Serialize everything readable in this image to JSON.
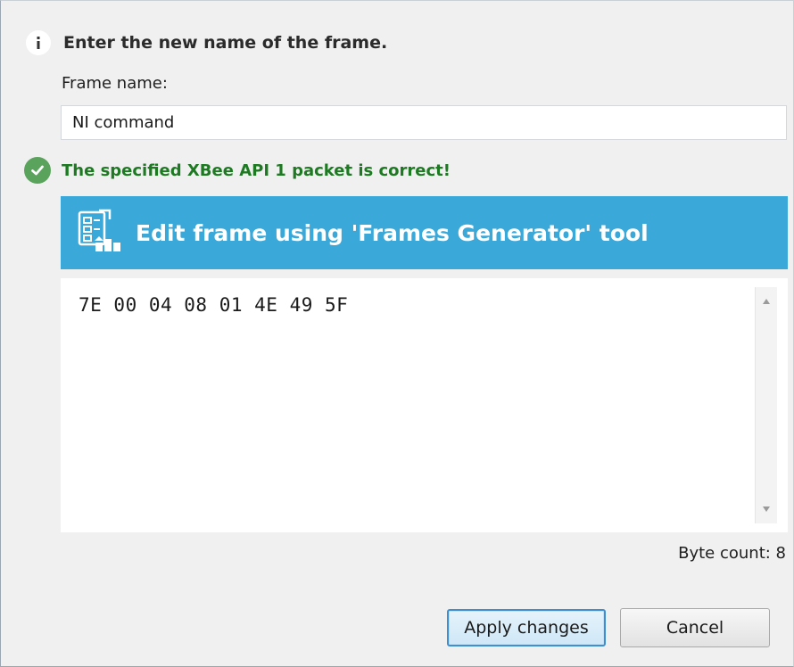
{
  "dialog": {
    "info_message": "Enter the new name of the frame.",
    "frame_name_label": "Frame name:",
    "frame_name_value": "NI command",
    "validation_message": "The specified XBee API 1 packet is correct!",
    "generator_button_label": "Edit frame using 'Frames Generator' tool",
    "frame_hex": "7E 00 04 08 01 4E 49 5F",
    "byte_count_label": "Byte count: 8",
    "apply_button": "Apply changes",
    "cancel_button": "Cancel"
  },
  "colors": {
    "banner": "#3aa8d8",
    "success_text": "#1e7a22",
    "success_icon": "#5aa35c",
    "background": "#f0f0f0"
  },
  "icons": {
    "info": "info-icon",
    "success": "check-circle-icon",
    "generator": "frames-generator-icon",
    "scroll_up": "chevron-up-icon",
    "scroll_down": "chevron-down-icon"
  }
}
